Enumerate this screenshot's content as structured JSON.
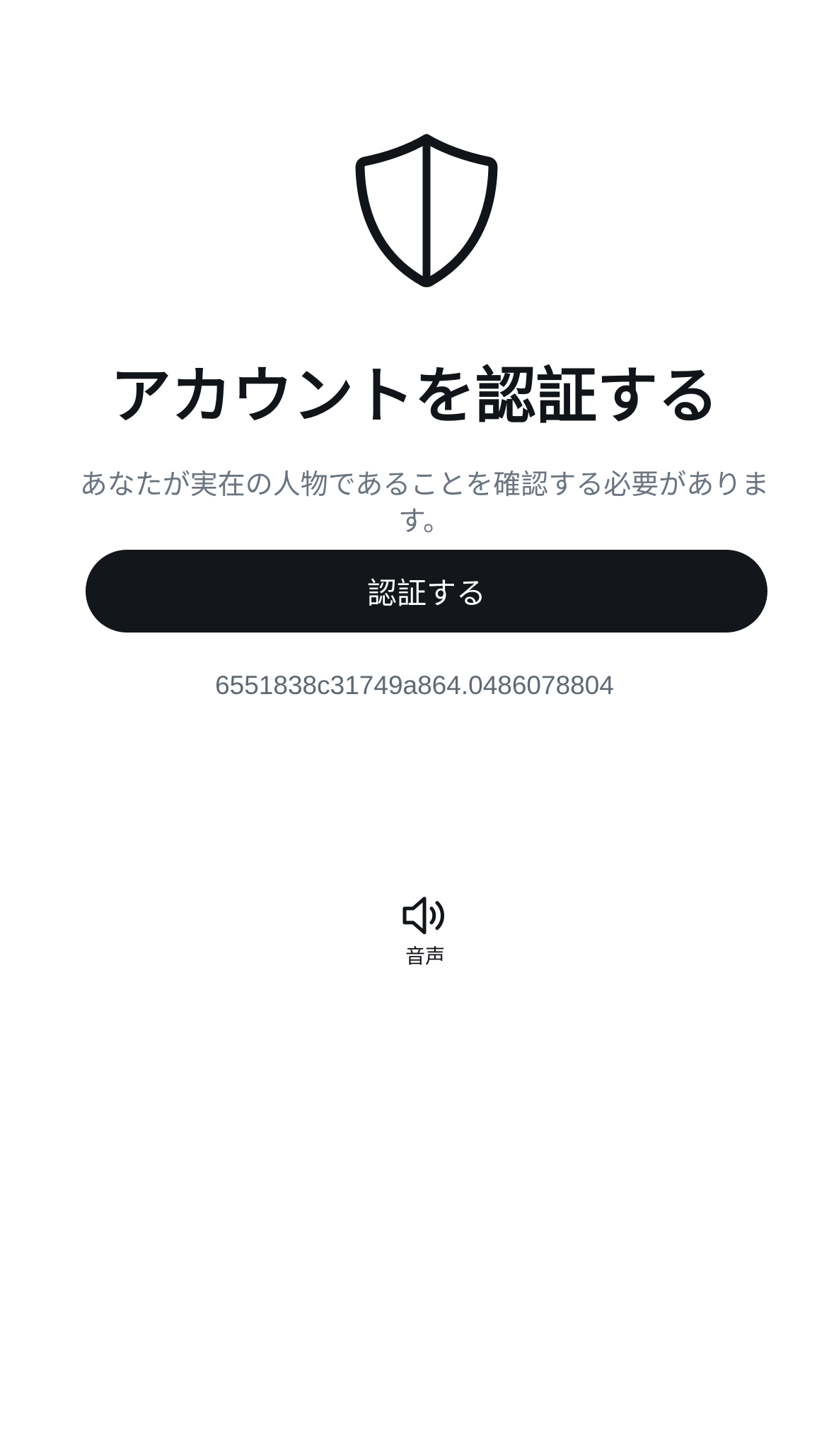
{
  "header": {
    "icon": "shield-icon",
    "title": "アカウントを認証する",
    "subtitle": "あなたが実在の人物であることを確認する必要があります。"
  },
  "actions": {
    "verify_label": "認証する"
  },
  "session": {
    "id": "6551838c31749a864.0486078804"
  },
  "audio": {
    "icon": "speaker-icon",
    "label": "音声"
  },
  "colors": {
    "background": "#ffffff",
    "primary_button": "#13161a",
    "title_text": "#111418",
    "secondary_text": "#6b7480"
  }
}
